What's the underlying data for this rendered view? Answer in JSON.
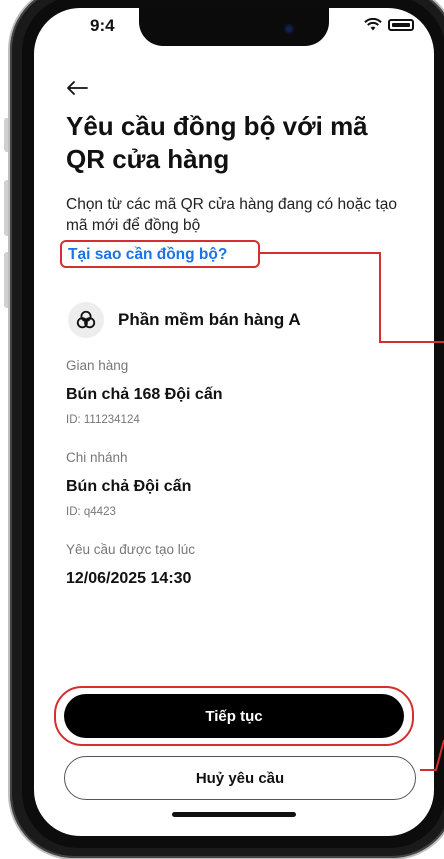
{
  "status_bar": {
    "time": "9:4"
  },
  "header": {
    "title": "Yêu cầu đồng bộ với mã QR cửa hàng",
    "description": "Chọn từ các mã QR cửa hàng đang có hoặc tạo mã mới để đồng bộ",
    "why_link": "Tại sao cần đồng bộ?"
  },
  "pos": {
    "name": "Phần mềm bán hàng A",
    "icon": "link-icon"
  },
  "info": {
    "store_label": "Gian hàng",
    "store_name": "Bún chả 168 Đội cấn",
    "store_id": "ID: 111234124",
    "branch_label": "Chi nhánh",
    "branch_name": "Bún chả Đội cấn",
    "branch_id": "ID: q4423",
    "created_label": "Yêu cầu được tạo lúc",
    "created_value": "12/06/2025 14:30"
  },
  "actions": {
    "continue_label": "Tiếp tục",
    "cancel_label": "Huỷ yêu cầu"
  },
  "colors": {
    "accent_link": "#1a73e8",
    "primary_button": "#000000",
    "annotation": "#d32f2f"
  }
}
